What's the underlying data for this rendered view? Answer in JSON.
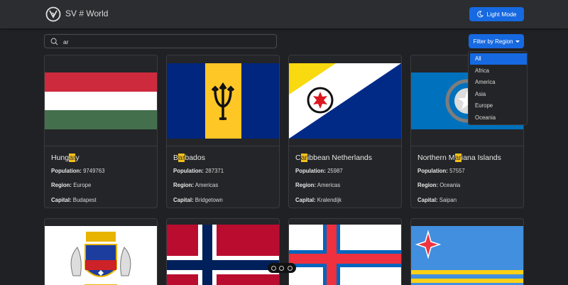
{
  "nav": {
    "brand": "SV # World",
    "mode_label": "Light Mode"
  },
  "search": {
    "value": "ar"
  },
  "filter": {
    "label": "Filter by Region",
    "options": [
      "All",
      "Africa",
      "America",
      "Asia",
      "Europe",
      "Oceania"
    ],
    "selected": "All"
  },
  "labels": {
    "population": "Population:",
    "region": "Region:",
    "capital": "Capital:"
  },
  "countries": [
    {
      "name_pre": "Hung",
      "name_hl": "ar",
      "name_post": "y",
      "population": "9749763",
      "region": "Europe",
      "capital": "Budapest"
    },
    {
      "name_pre": "B",
      "name_hl": "ar",
      "name_post": "bados",
      "population": "287371",
      "region": "Americas",
      "capital": "Bridgetown"
    },
    {
      "name_pre": "C",
      "name_hl": "ar",
      "name_post": "ibbean Netherlands",
      "population": "25987",
      "region": "Americas",
      "capital": "Kralendijk"
    },
    {
      "name_pre": "Northern M",
      "name_hl": "ar",
      "name_post": "iana Islands",
      "population": "57557",
      "region": "Oceania",
      "capital": "Saipan"
    }
  ],
  "colors": {
    "accent": "#1669e0",
    "highlight": "#f2c01c",
    "background": "#202124"
  }
}
